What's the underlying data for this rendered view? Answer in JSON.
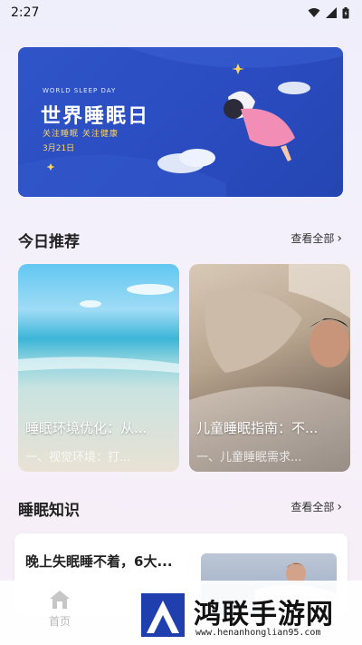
{
  "status_bar": {
    "time": "2:27"
  },
  "banner": {
    "subtitle_en": "WORLD SLEEP DAY",
    "title": "世界睡眠日",
    "tagline": "关注睡眠  关注健康",
    "date": "3月21日"
  },
  "today": {
    "title": "今日推荐",
    "more": "查看全部",
    "cards": [
      {
        "title": "睡眠环境优化：从...",
        "desc": "一、视觉环境：打..."
      },
      {
        "title": "儿童睡眠指南：不...",
        "desc": "一、儿童睡眠需求..."
      }
    ]
  },
  "knowledge": {
    "title": "睡眠知识",
    "more": "查看全部",
    "items": [
      {
        "title": "晚上失眠睡不着，6大..."
      }
    ]
  },
  "tabbar": {
    "home_label": "首页"
  },
  "watermark": {
    "title": "鸿联手游网",
    "url": "www.henanhonglian95.com"
  },
  "colors": {
    "banner_blue": "#2a4cc0",
    "banner_accent": "#ffd45a"
  }
}
